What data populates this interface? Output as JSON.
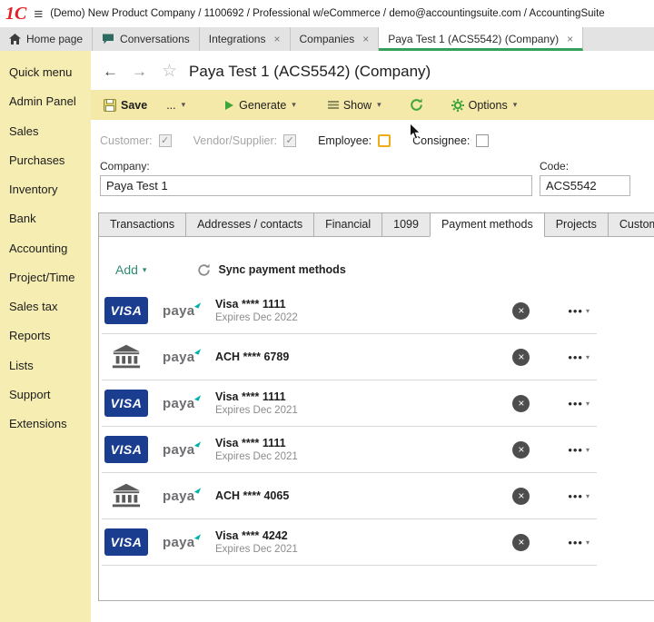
{
  "app": {
    "logo": "1С",
    "header_text": "(Demo) New Product Company / 1100692 / Professional w/eCommerce / demo@accountingsuite.com / AccountingSuite"
  },
  "window_tabs": [
    {
      "label": "Home page",
      "icon": "home",
      "closable": false,
      "active": false
    },
    {
      "label": "Conversations",
      "icon": "chat",
      "closable": false,
      "active": false
    },
    {
      "label": "Integrations",
      "icon": "",
      "closable": true,
      "active": false
    },
    {
      "label": "Companies",
      "icon": "",
      "closable": true,
      "active": false
    },
    {
      "label": "Paya Test 1 (ACS5542) (Company)",
      "icon": "",
      "closable": true,
      "active": true
    }
  ],
  "sidebar": {
    "items": [
      "Quick menu",
      "Admin Panel",
      "Sales",
      "Purchases",
      "Inventory",
      "Bank",
      "Accounting",
      "Project/Time",
      "Sales tax",
      "Reports",
      "Lists",
      "Support",
      "Extensions"
    ]
  },
  "page": {
    "title": "Paya Test 1 (ACS5542) (Company)",
    "toolbar": {
      "save": "Save",
      "more": "...",
      "generate": "Generate",
      "show": "Show",
      "options": "Options"
    },
    "roles": [
      {
        "label": "Customer:",
        "checked": true,
        "disabled": true,
        "focused": false
      },
      {
        "label": "Vendor/Supplier:",
        "checked": true,
        "disabled": true,
        "focused": false
      },
      {
        "label": "Employee:",
        "checked": false,
        "disabled": false,
        "focused": true
      },
      {
        "label": "Consignee:",
        "checked": false,
        "disabled": false,
        "focused": false
      }
    ],
    "fields": {
      "company_label": "Company:",
      "company_value": "Paya Test 1",
      "code_label": "Code:",
      "code_value": "ACS5542"
    },
    "detail_tabs": [
      {
        "label": "Transactions",
        "active": false
      },
      {
        "label": "Addresses / contacts",
        "active": false
      },
      {
        "label": "Financial",
        "active": false
      },
      {
        "label": "1099",
        "active": false
      },
      {
        "label": "Payment methods",
        "active": true
      },
      {
        "label": "Projects",
        "active": false
      },
      {
        "label": "Custom fields",
        "active": false
      }
    ],
    "payment_methods": {
      "add_label": "Add",
      "sync_label": "Sync payment methods",
      "rows": [
        {
          "type": "visa",
          "title": "Visa **** 1111",
          "subtitle": "Expires Dec 2022"
        },
        {
          "type": "bank",
          "title": "ACH **** 6789",
          "subtitle": ""
        },
        {
          "type": "visa",
          "title": "Visa **** 1111",
          "subtitle": "Expires Dec 2021"
        },
        {
          "type": "visa",
          "title": "Visa **** 1111",
          "subtitle": "Expires Dec 2021"
        },
        {
          "type": "bank",
          "title": "ACH **** 4065",
          "subtitle": ""
        },
        {
          "type": "visa",
          "title": "Visa **** 4242",
          "subtitle": "Expires Dec 2021"
        }
      ]
    }
  },
  "colors": {
    "accent_red": "#e31e24",
    "sidebar_bg": "#f6edb3",
    "toolbar_bg": "#f5e9a9",
    "active_tab_underline": "#35a05a",
    "icon_green": "#3da639",
    "link_teal": "#2e8b74",
    "visa_navy": "#1a3d8f",
    "paya_teal": "#00b2a9",
    "delete_circle_gray": "#4d4d4d"
  }
}
